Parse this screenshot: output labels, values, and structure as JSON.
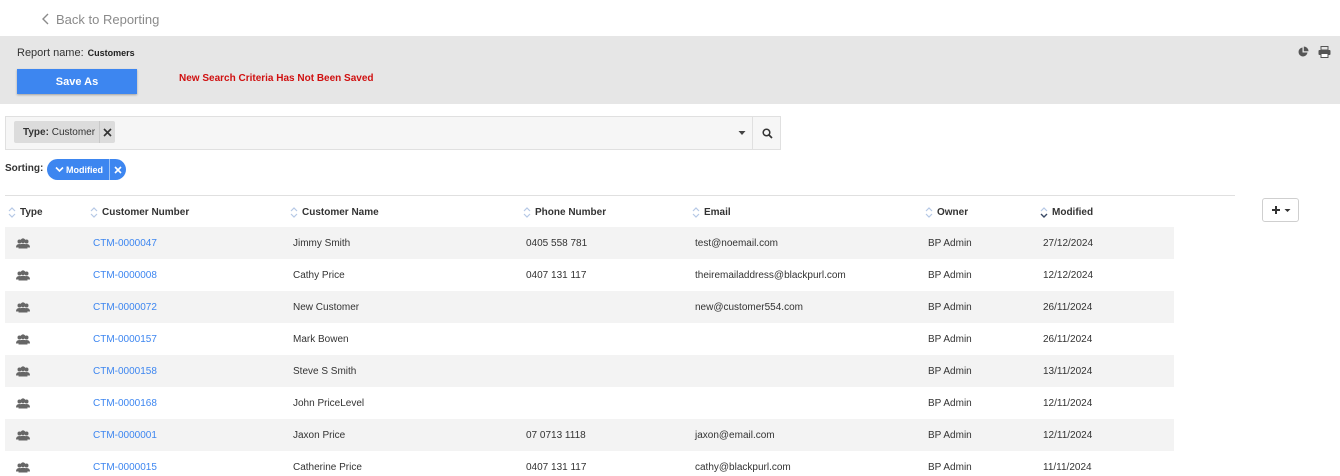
{
  "nav": {
    "back_label": "Back to Reporting"
  },
  "report": {
    "name_label": "Report name:",
    "name_value": "Customers",
    "save_as_label": "Save As",
    "unsaved_message": "New Search Criteria Has Not Been Saved"
  },
  "filter": {
    "chip_key": "Type:",
    "chip_value": "Customer"
  },
  "sorting": {
    "label": "Sorting:",
    "active": "Modified"
  },
  "table": {
    "columns": [
      "Type",
      "Customer Number",
      "Customer Name",
      "Phone Number",
      "Email",
      "Owner",
      "Modified"
    ],
    "rows": [
      {
        "number": "CTM-0000047",
        "name": "Jimmy Smith",
        "phone": "0405 558 781",
        "email": "test@noemail.com",
        "owner": "BP Admin",
        "modified": "27/12/2024"
      },
      {
        "number": "CTM-0000008",
        "name": "Cathy Price",
        "phone": "0407 131 117",
        "email": "theiremailaddress@blackpurl.com",
        "owner": "BP Admin",
        "modified": "12/12/2024"
      },
      {
        "number": "CTM-0000072",
        "name": "New Customer",
        "phone": "",
        "email": "new@customer554.com",
        "owner": "BP Admin",
        "modified": "26/11/2024"
      },
      {
        "number": "CTM-0000157",
        "name": "Mark Bowen",
        "phone": "",
        "email": "",
        "owner": "BP Admin",
        "modified": "26/11/2024"
      },
      {
        "number": "CTM-0000158",
        "name": "Steve S Smith",
        "phone": "",
        "email": "",
        "owner": "BP Admin",
        "modified": "13/11/2024"
      },
      {
        "number": "CTM-0000168",
        "name": "John PriceLevel",
        "phone": "",
        "email": "",
        "owner": "BP Admin",
        "modified": "12/11/2024"
      },
      {
        "number": "CTM-0000001",
        "name": "Jaxon Price",
        "phone": "07 0713 1118",
        "email": "jaxon@email.com",
        "owner": "BP Admin",
        "modified": "12/11/2024"
      },
      {
        "number": "CTM-0000015",
        "name": "Catherine Price",
        "phone": "0407 131 117",
        "email": "cathy@blackpurl.com",
        "owner": "BP Admin",
        "modified": "11/11/2024"
      }
    ]
  },
  "icons": {
    "back": "chevron-left-icon",
    "pie": "pie-chart-icon",
    "print": "printer-icon",
    "remove": "close-icon",
    "dropdown": "caret-down-icon",
    "search": "search-icon",
    "sort": "sort-icon",
    "add_column": "plus-icon",
    "customer_type": "users-icon"
  },
  "colors": {
    "accent": "#3d86f0",
    "warning": "#d01010",
    "toolbar_bg": "#e6e6e6"
  }
}
